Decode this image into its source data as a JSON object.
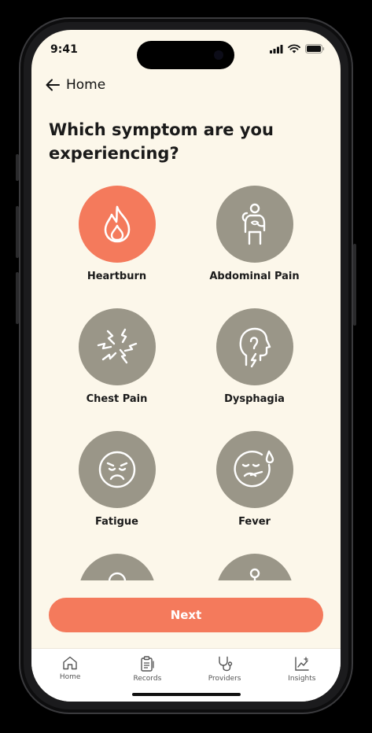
{
  "status_bar": {
    "time": "9:41"
  },
  "nav": {
    "back_label": "Home"
  },
  "question": "Which symptom are you experiencing?",
  "symptoms": [
    {
      "label": "Heartburn",
      "icon": "flame-icon",
      "selected": true
    },
    {
      "label": "Abdominal Pain",
      "icon": "stomach-pain-icon",
      "selected": false
    },
    {
      "label": "Chest Pain",
      "icon": "chest-pain-icon",
      "selected": false
    },
    {
      "label": "Dysphagia",
      "icon": "throat-icon",
      "selected": false
    },
    {
      "label": "Fatigue",
      "icon": "tired-face-icon",
      "selected": false
    },
    {
      "label": "Fever",
      "icon": "sick-face-icon",
      "selected": false
    }
  ],
  "next_button": {
    "label": "Next"
  },
  "tabbar": {
    "items": [
      {
        "label": "Home",
        "icon": "home-icon"
      },
      {
        "label": "Records",
        "icon": "clipboard-icon"
      },
      {
        "label": "Providers",
        "icon": "stethoscope-icon"
      },
      {
        "label": "Insights",
        "icon": "chart-icon"
      }
    ]
  },
  "colors": {
    "background": "#fcf7ea",
    "accent": "#f47a5c",
    "inactive_circle": "#9a9688",
    "text": "#1a1a1a"
  }
}
